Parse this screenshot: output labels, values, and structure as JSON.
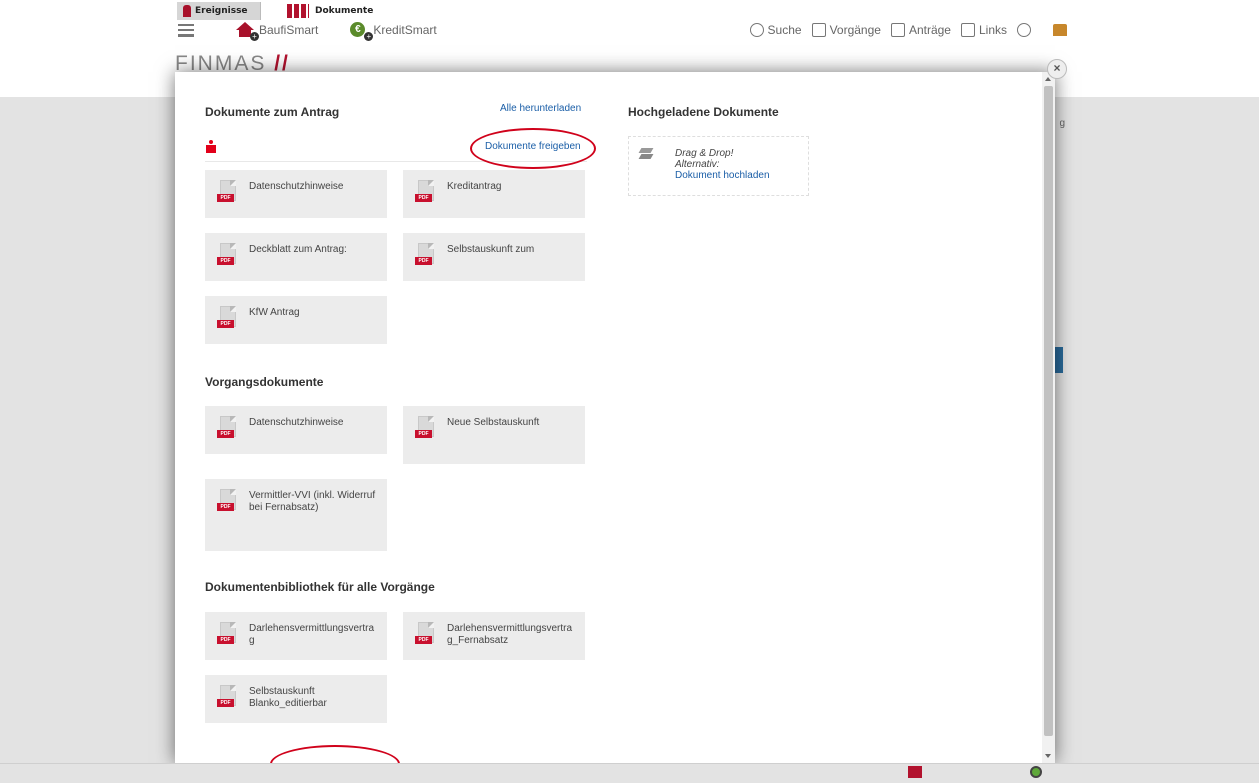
{
  "app": {
    "brands": [
      "BaufiSmart",
      "KreditSmart"
    ],
    "nav": {
      "search": "Suche",
      "cases": "Vorgänge",
      "applications": "Anträge",
      "links": "Links"
    },
    "logo_text": "FINMAS",
    "logo_slash": "//",
    "bg_cut_text": "g"
  },
  "modal": {
    "close_glyph": "×",
    "section_application": {
      "title": "Dokumente zum Antrag",
      "download_all": "Alle herunterladen",
      "release_docs": "Dokumente freigeben",
      "documents": [
        {
          "label": "Datenschutzhinweise",
          "type": "PDF"
        },
        {
          "label": "Kreditantrag",
          "type": "PDF"
        },
        {
          "label": "Deckblatt zum Antrag:",
          "type": "PDF"
        },
        {
          "label": "Selbstauskunft zum",
          "type": "PDF"
        },
        {
          "label": "KfW Antrag",
          "type": "PDF"
        }
      ]
    },
    "section_case": {
      "title": "Vorgangsdokumente",
      "documents": [
        {
          "label": "Datenschutzhinweise",
          "type": "PDF"
        },
        {
          "label": "Neue Selbstauskunft",
          "type": "PDF"
        },
        {
          "label": "Vermittler-VVI (inkl. Widerruf bei Fernabsatz)",
          "type": "PDF"
        }
      ]
    },
    "section_library": {
      "title": "Dokumentenbibliothek für alle Vorgänge",
      "documents": [
        {
          "label": "Darlehensvermittlungsvertrag",
          "type": "PDF"
        },
        {
          "label": "Darlehensvermittlungsvertrag_Fernabsatz",
          "type": "PDF"
        },
        {
          "label": "Selbstauskunft Blanko_editierbar",
          "type": "PDF"
        }
      ]
    },
    "uploaded": {
      "title": "Hochgeladene Dokumente",
      "drag_drop": "Drag & Drop!",
      "alternative": "Alternativ:",
      "upload_link": "Dokument hochladen"
    }
  },
  "bottom_bar": {
    "events_label": "Ereignisse",
    "documents_label": "Dokumente"
  },
  "colors": {
    "accent_red": "#b2122e",
    "link_blue": "#1a5ea7",
    "annotation_red": "#d0021b"
  }
}
